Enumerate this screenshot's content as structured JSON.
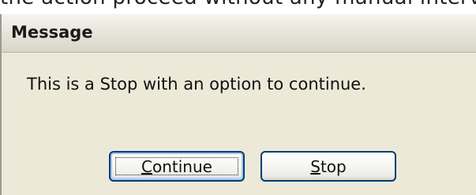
{
  "background_text": "the action proceed without any manual interve",
  "dialog": {
    "title": "Message",
    "message": "This is a Stop with an option to continue.",
    "buttons": {
      "continue": {
        "mnemonic": "C",
        "rest": "ontinue",
        "label": "Continue"
      },
      "stop": {
        "mnemonic": "S",
        "rest": "top",
        "label": "Stop"
      }
    }
  },
  "colors": {
    "dialog_background": "#ece9d8",
    "button_border": "#003c74",
    "focus_highlight": "#a8c4e8"
  }
}
